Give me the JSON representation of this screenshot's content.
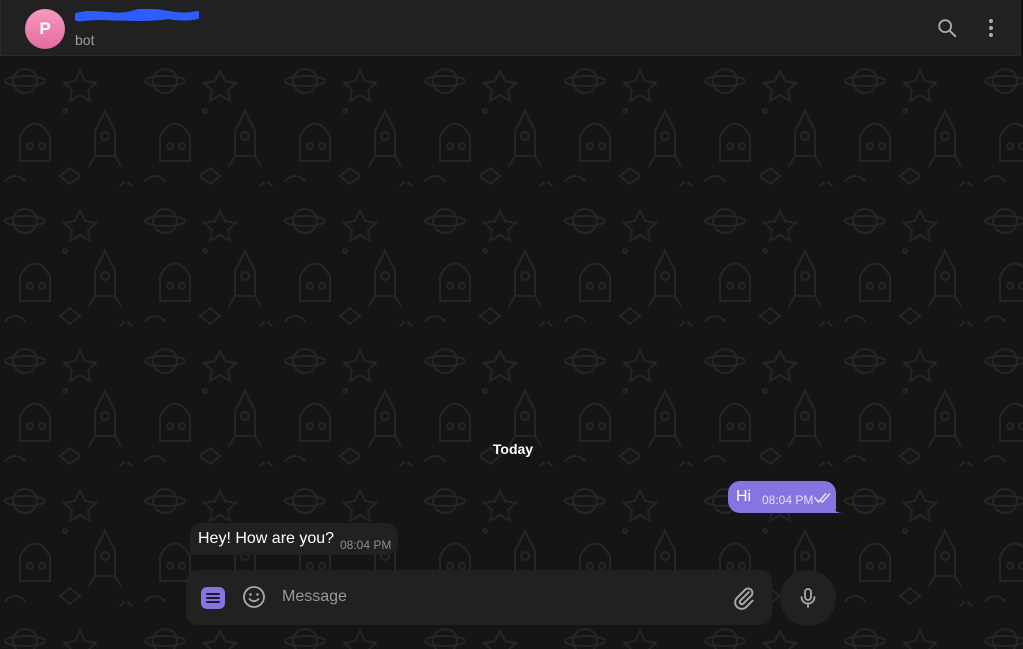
{
  "header": {
    "avatar_letter": "P",
    "name": "P",
    "subtitle": "bot",
    "icons": {
      "search": "search-icon",
      "more": "more-vertical-icon"
    }
  },
  "chat": {
    "date_label": "Today",
    "messages": [
      {
        "direction": "outgoing",
        "text": "Hi",
        "time": "08:04 PM",
        "status": "read-double-check"
      },
      {
        "direction": "incoming",
        "text": "Hey! How are you?",
        "time": "08:04 PM"
      }
    ]
  },
  "composer": {
    "placeholder": "Message",
    "value": "",
    "icons": {
      "menu": "menu-icon",
      "emoji": "emoji-icon",
      "attach": "paperclip-icon",
      "mic": "microphone-icon"
    }
  },
  "colors": {
    "accent": "#8774e1",
    "header_bg": "#212121",
    "chat_bg": "#151515",
    "incoming_bubble": "#212121",
    "avatar": "#ee7fae",
    "redaction": "#2f5cff"
  }
}
